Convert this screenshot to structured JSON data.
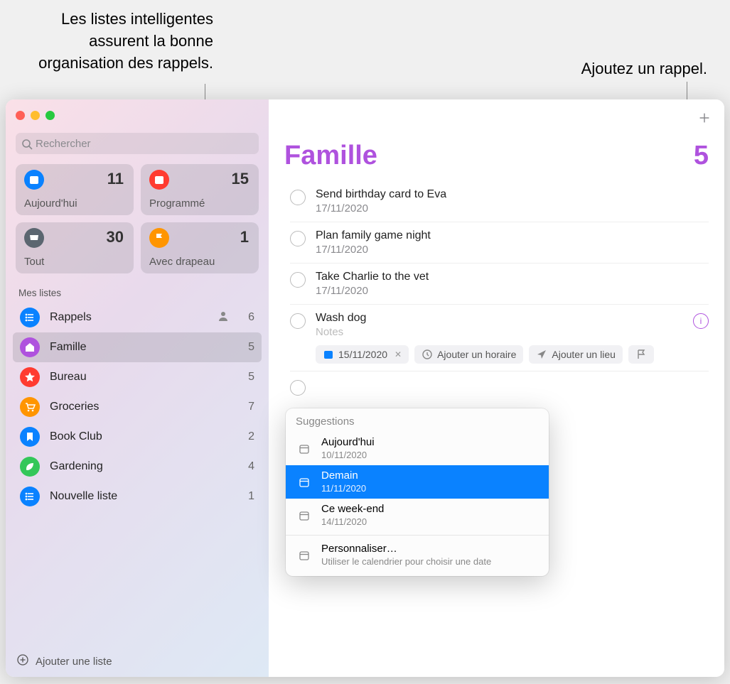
{
  "annotations": {
    "smart_lists": "Les listes intelligentes assurent la bonne organisation des rappels.",
    "add_reminder": "Ajoutez un rappel."
  },
  "sidebar": {
    "search_placeholder": "Rechercher",
    "smart": [
      {
        "label": "Aujourd'hui",
        "count": "11",
        "color": "#0a82ff",
        "icon": "calendar"
      },
      {
        "label": "Programmé",
        "count": "15",
        "color": "#ff3b30",
        "icon": "calendar"
      },
      {
        "label": "Tout",
        "count": "30",
        "color": "#5b6670",
        "icon": "inbox"
      },
      {
        "label": "Avec drapeau",
        "count": "1",
        "color": "#ff9500",
        "icon": "flag"
      }
    ],
    "section_header": "Mes listes",
    "lists": [
      {
        "name": "Rappels",
        "count": "6",
        "color": "#0a82ff",
        "icon": "list",
        "shared": true
      },
      {
        "name": "Famille",
        "count": "5",
        "color": "#af52de",
        "icon": "home",
        "selected": true
      },
      {
        "name": "Bureau",
        "count": "5",
        "color": "#ff3b30",
        "icon": "star"
      },
      {
        "name": "Groceries",
        "count": "7",
        "color": "#ff9500",
        "icon": "cart"
      },
      {
        "name": "Book Club",
        "count": "2",
        "color": "#0a82ff",
        "icon": "bookmark"
      },
      {
        "name": "Gardening",
        "count": "4",
        "color": "#34c759",
        "icon": "leaf"
      },
      {
        "name": "Nouvelle liste",
        "count": "1",
        "color": "#0a82ff",
        "icon": "list"
      }
    ],
    "add_list_label": "Ajouter une liste"
  },
  "main": {
    "title": "Famille",
    "total": "5",
    "reminders": [
      {
        "title": "Send birthday card to Eva",
        "date": "17/11/2020"
      },
      {
        "title": "Plan family game night",
        "date": "17/11/2020"
      },
      {
        "title": "Take Charlie to the vet",
        "date": "17/11/2020"
      },
      {
        "title": "Wash dog",
        "notes_placeholder": "Notes",
        "editing": true,
        "date_chip": "15/11/2020",
        "time_chip": "Ajouter un horaire",
        "location_chip": "Ajouter un lieu"
      }
    ],
    "suggestions": {
      "header": "Suggestions",
      "items": [
        {
          "title": "Aujourd'hui",
          "sub": "10/11/2020"
        },
        {
          "title": "Demain",
          "sub": "11/11/2020",
          "highlight": true
        },
        {
          "title": "Ce week-end",
          "sub": "14/11/2020"
        }
      ],
      "custom": {
        "title": "Personnaliser…",
        "sub": "Utiliser le calendrier pour choisir une date"
      }
    }
  }
}
